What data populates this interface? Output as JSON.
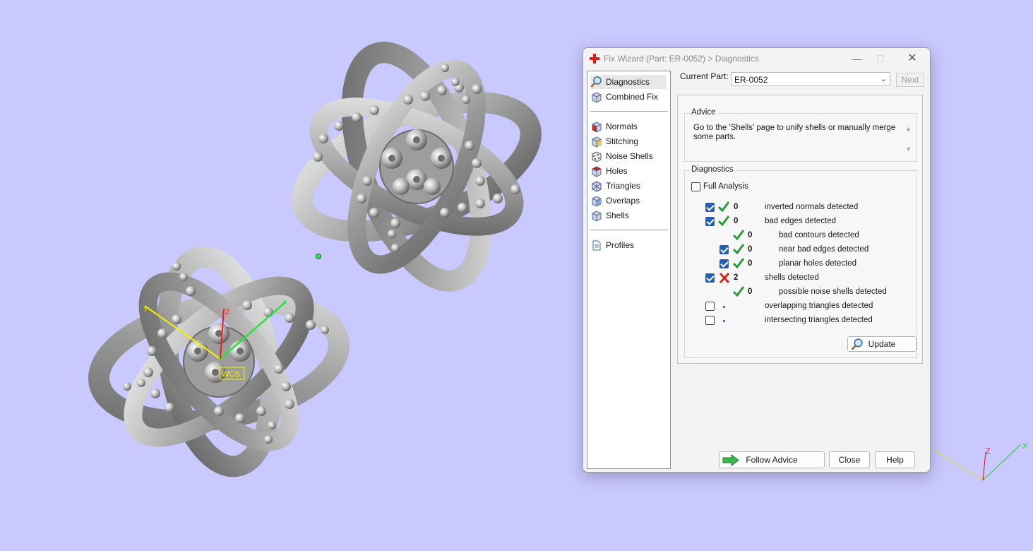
{
  "colors": {
    "viewport_bg": "#c9c8ff",
    "accent": "#1f5fba",
    "ok_green": "#2e9a3e",
    "error_red": "#d9261c"
  },
  "viewport": {
    "wcs_label": "WCS",
    "axes": {
      "x": "X",
      "y": "Y",
      "z": "Z"
    }
  },
  "dialog": {
    "title": "Fix Wizard (Part: ER-0052) > Diagnostics",
    "nav": {
      "items": [
        {
          "label": "Diagnostics",
          "icon": "magnifier-icon"
        },
        {
          "label": "Combined Fix",
          "icon": "cube-icon"
        },
        {
          "label": "Normals",
          "icon": "red-cube-icon"
        },
        {
          "label": "Stitching",
          "icon": "stitching-cube-icon"
        },
        {
          "label": "Noise Shells",
          "icon": "noise-shells-icon"
        },
        {
          "label": "Holes",
          "icon": "holes-cube-icon"
        },
        {
          "label": "Triangles",
          "icon": "triangles-cube-icon"
        },
        {
          "label": "Overlaps",
          "icon": "overlaps-cube-icon"
        },
        {
          "label": "Shells",
          "icon": "shells-cube-icon"
        },
        {
          "label": "Profiles",
          "icon": "document-icon"
        }
      ]
    },
    "current_part": {
      "label": "Current Part:",
      "value": "ER-0052"
    },
    "next_label": "Next",
    "advice": {
      "title": "Advice",
      "text": "Go to the 'Shells' page to unify shells or manually merge some parts."
    },
    "diagnostics": {
      "title": "Diagnostics",
      "full_analysis": {
        "label": "Full Analysis",
        "checked": false
      },
      "rows": [
        {
          "label": "inverted normals detected",
          "count": "0",
          "status": "ok",
          "checked": true
        },
        {
          "label": "bad edges detected",
          "count": "0",
          "status": "ok",
          "checked": true
        },
        {
          "label": "bad contours detected",
          "count": "0",
          "status": "ok",
          "checked": null
        },
        {
          "label": "near bad edges detected",
          "count": "0",
          "status": "ok",
          "checked": true
        },
        {
          "label": "planar holes detected",
          "count": "0",
          "status": "ok",
          "checked": true
        },
        {
          "label": "shells detected",
          "count": "2",
          "status": "error",
          "checked": true
        },
        {
          "label": "possible noise shells detected",
          "count": "0",
          "status": "ok",
          "checked": null
        },
        {
          "label": "overlapping triangles detected",
          "count": "",
          "status": "pending",
          "checked": false
        },
        {
          "label": "intersecting triangles detected",
          "count": "",
          "status": "pending",
          "checked": false
        }
      ],
      "update_label": "Update"
    },
    "buttons": {
      "follow_advice": "Follow Advice",
      "close": "Close",
      "help": "Help"
    }
  }
}
